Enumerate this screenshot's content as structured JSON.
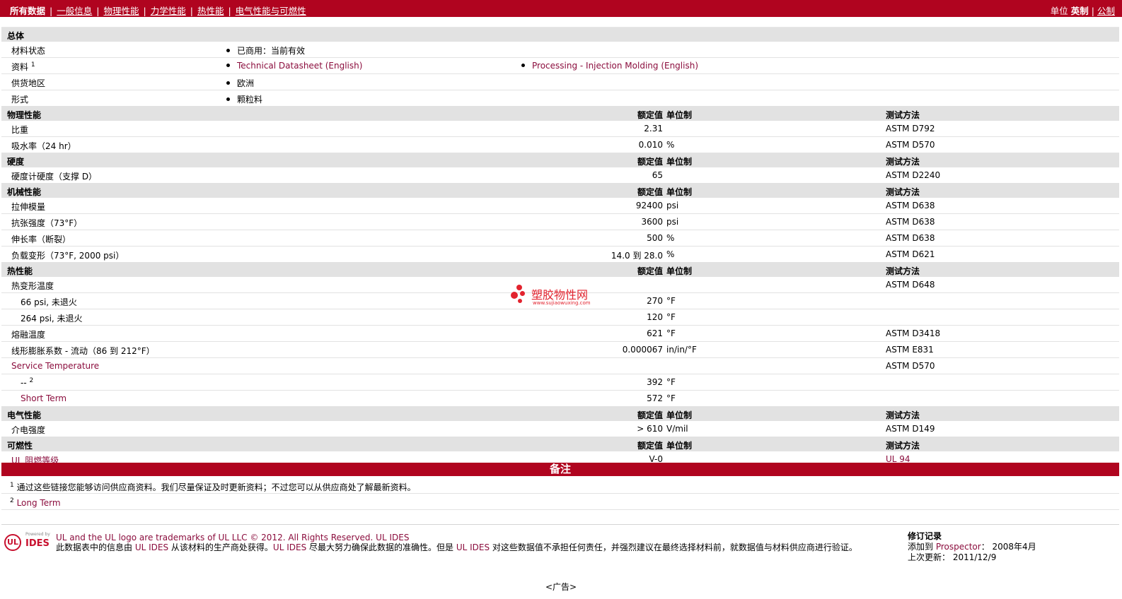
{
  "topbar": {
    "nav": [
      {
        "label": "所有数据",
        "current": true
      },
      {
        "label": "一般信息"
      },
      {
        "label": "物理性能"
      },
      {
        "label": "力学性能"
      },
      {
        "label": "热性能"
      },
      {
        "label": "电气性能与可燃性"
      }
    ],
    "units_label": "单位",
    "unit_selected": "英制",
    "unit_alt": "公制"
  },
  "general": {
    "title": "总体",
    "rows": [
      {
        "name": "材料状态",
        "v1": "已商用：当前有效"
      },
      {
        "name": "资料",
        "sup": "1",
        "v1": "Technical Datasheet (English)",
        "v2": "Processing - Injection Molding (English)"
      },
      {
        "name": "供货地区",
        "v1": "欧洲"
      },
      {
        "name": "形式",
        "v1": "颗粒料"
      }
    ]
  },
  "col_headers": {
    "nominal": "额定值",
    "unit": "单位制",
    "method": "测试方法"
  },
  "sections": [
    {
      "title": "物理性能",
      "rows": [
        {
          "name": "比重",
          "value": "2.31",
          "unit": "",
          "method": "ASTM D792"
        },
        {
          "name": "吸水率（24 hr）",
          "value": "0.010",
          "unit": "%",
          "method": "ASTM D570"
        }
      ]
    },
    {
      "title": "硬度",
      "rows": [
        {
          "name": "硬度计硬度（支撑 D）",
          "value": "65",
          "unit": "",
          "method": "ASTM D2240"
        }
      ]
    },
    {
      "title": "机械性能",
      "rows": [
        {
          "name": "拉伸模量",
          "value": "92400",
          "unit": "psi",
          "method": "ASTM D638"
        },
        {
          "name": "抗张强度（73°F）",
          "value": "3600",
          "unit": "psi",
          "method": "ASTM D638"
        },
        {
          "name": "伸长率（断裂）",
          "value": "500",
          "unit": "%",
          "method": "ASTM D638"
        },
        {
          "name": "负载变形（73°F, 2000 psi）",
          "value": "14.0 到  28.0",
          "unit": "%",
          "method": "ASTM D621"
        }
      ]
    },
    {
      "title": "热性能",
      "rows": [
        {
          "name": "热变形温度",
          "value": "",
          "unit": "",
          "method": "ASTM D648"
        },
        {
          "name": "66 psi, 未退火",
          "indent": true,
          "value": "270",
          "unit": "°F",
          "method": ""
        },
        {
          "name": "264 psi, 未退火",
          "indent": true,
          "value": "120",
          "unit": "°F",
          "method": ""
        },
        {
          "name": "熔融温度",
          "value": "621",
          "unit": "°F",
          "method": "ASTM D3418"
        },
        {
          "name": "线形膨胀系数 - 流动（86 到  212°F）",
          "value": "0.000067",
          "unit": "in/in/°F",
          "method": "ASTM E831"
        },
        {
          "name": "Service Temperature",
          "link": true,
          "value": "",
          "unit": "",
          "method": "ASTM D570"
        },
        {
          "name": "--",
          "sup": "2",
          "indent": true,
          "value": "392",
          "unit": "°F",
          "method": ""
        },
        {
          "name": "Short Term",
          "link": true,
          "indent": true,
          "value": "572",
          "unit": "°F",
          "method": ""
        }
      ]
    },
    {
      "title": "电气性能",
      "rows": [
        {
          "name": "介电强度",
          "value": "> 610",
          "unit": "V/mil",
          "method": "ASTM D149"
        }
      ]
    },
    {
      "title": "可燃性",
      "rows": [
        {
          "name": "UL 阻燃等级",
          "link": true,
          "value": "V-0",
          "unit": "",
          "method": "UL 94",
          "method_link": true
        }
      ]
    }
  ],
  "notes": {
    "title": "备注",
    "items": [
      {
        "sup": "1",
        "text": "通过这些链接您能够访问供应商资料。我们尽量保证及时更新资料；不过您可以从供应商处了解最新资料。"
      },
      {
        "sup": "2",
        "text": "Long Term"
      }
    ]
  },
  "watermark": {
    "text": "塑胶物性网",
    "url": "www.sujiaowuxing.com"
  },
  "footer": {
    "logo_powered": "Powered by",
    "logo_ul": "UL",
    "logo_ides": "IDES",
    "line1": "UL and the UL logo are trademarks of UL LLC © 2012. All Rights Reserved. UL IDES",
    "d1": "此数据表中的信息由 ",
    "d_link1": "UL IDES",
    "d2": " 从该材料的生产商处获得。",
    "d_link2": "UL IDES",
    "d3": " 尽最大努力确保此数据的准确性。但是 ",
    "d_link3": "UL IDES",
    "d4": " 对这些数据值不承担任何责任，并强烈建议在最终选择材料前，就数据值与材料供应商进行验证。",
    "rev_title": "修订记录",
    "rev_added_label": "添加到 ",
    "rev_added_link": "Prospector",
    "rev_added_date": "：   2008年4月",
    "rev_updated": "上次更新：   2011/12/9"
  },
  "ad": "<广告>"
}
